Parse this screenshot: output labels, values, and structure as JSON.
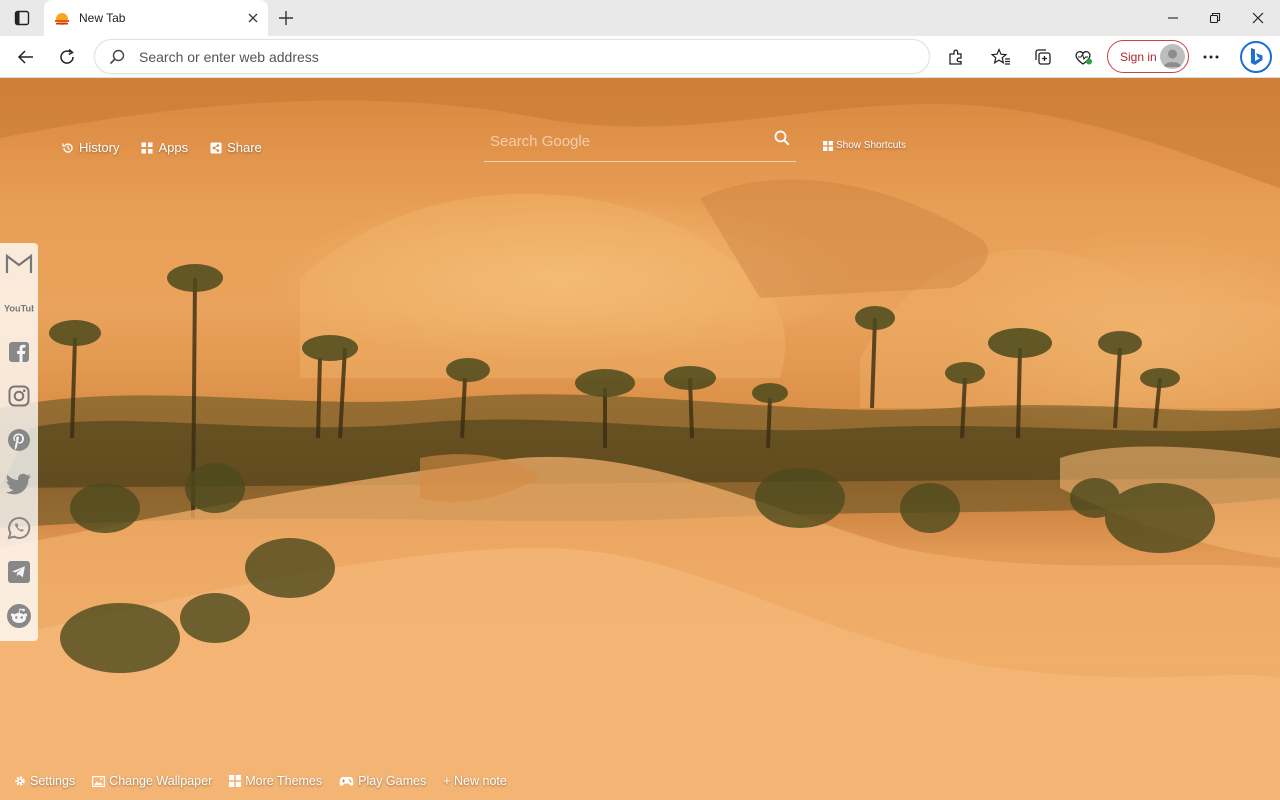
{
  "browser": {
    "tab": {
      "title": "New Tab",
      "favicon": "sunset-favicon-icon"
    },
    "window_buttons": [
      "minimize-icon",
      "restore-icon",
      "close-icon"
    ]
  },
  "toolbar": {
    "address_placeholder": "Search or enter web address",
    "sign_in_label": "Sign in",
    "icons": [
      "back-icon",
      "refresh-icon",
      "search-icon",
      "extensions-icon",
      "favorites-icon",
      "collections-icon",
      "browser-essentials-icon",
      "more-icon",
      "bing-copilot-icon"
    ]
  },
  "newtab": {
    "top_links": [
      {
        "label": "History",
        "icon": "history-icon"
      },
      {
        "label": "Apps",
        "icon": "apps-grid-icon"
      },
      {
        "label": "Share",
        "icon": "share-icon"
      }
    ],
    "search_placeholder": "Search Google",
    "show_shortcuts_label": "Show Shortcuts",
    "social_icons": [
      "gmail-icon",
      "youtube-icon",
      "facebook-icon",
      "instagram-icon",
      "pinterest-icon",
      "twitter-icon",
      "whatsapp-icon",
      "telegram-icon",
      "reddit-icon"
    ],
    "youtube_text": "YouTube",
    "bottom_links": [
      {
        "label": "Settings",
        "icon": "gear-icon"
      },
      {
        "label": "Change Wallpaper",
        "icon": "image-icon"
      },
      {
        "label": "More Themes",
        "icon": "grid-icon"
      },
      {
        "label": "Play Games",
        "icon": "gamepad-icon"
      },
      {
        "label": "+ New note",
        "icon": ""
      }
    ]
  }
}
